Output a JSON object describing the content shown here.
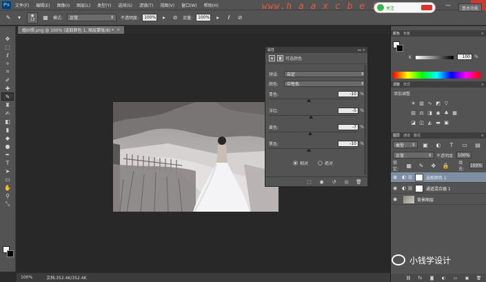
{
  "app": {
    "logo": "Ps",
    "menus": [
      "文件(F)",
      "编辑(E)",
      "图像(I)",
      "图层(L)",
      "类型(Y)",
      "选择(S)",
      "滤镜(T)",
      "视图(V)",
      "窗口(W)",
      "帮助(H)"
    ],
    "window_controls": [
      "—",
      "□",
      "✕"
    ]
  },
  "options_bar": {
    "brush_size": "13",
    "mode_label": "模式:",
    "mode_value": "正常",
    "opacity_label": "不透明度:",
    "opacity_value": "100%",
    "flow_label": "流量:",
    "flow_value": "100%",
    "workspace": "基本功能",
    "watermark": "www.h a a x c b e i . c o m",
    "badge_text": "关注"
  },
  "document": {
    "tab_title": "婚纱照.png @ 100% (选取颜色 1, 图层蒙版/8) *",
    "close": "×"
  },
  "status": {
    "zoom": "100%",
    "doc_info": "文档:352.4K/352.4K"
  },
  "properties": {
    "header": "属性",
    "title": "可选颜色",
    "preset_label": "预设:",
    "preset_value": "自定",
    "colors_label": "颜色:",
    "colors_value": "中性色",
    "sliders": [
      {
        "label": "青色:",
        "value": "-10",
        "unit": "%",
        "pct": -10
      },
      {
        "label": "洋红:",
        "value": "-5",
        "unit": "%",
        "pct": -5
      },
      {
        "label": "黄色:",
        "value": "-7",
        "unit": "%",
        "pct": -7
      },
      {
        "label": "黑色:",
        "value": "-10",
        "unit": "%",
        "pct": -10
      }
    ],
    "radio_relative": "相对",
    "radio_absolute": "绝对"
  },
  "color_panel": {
    "tabs": [
      "颜色",
      "色板"
    ],
    "k_label": "K",
    "k_value": "100",
    "k_unit": "%"
  },
  "adjust_panel": {
    "tabs": [
      "调整",
      "样式"
    ],
    "title": "添加调整"
  },
  "layers_panel": {
    "tabs": [
      "图层",
      "通道",
      "路径"
    ],
    "kind_value": "类型",
    "blend_value": "正常",
    "opacity_label": "不透明度:",
    "opacity_value": "100%",
    "lock_label": "锁定:",
    "fill_label": "填充:",
    "fill_value": "100%",
    "layers": [
      {
        "name": "选取颜色 1",
        "selected": true
      },
      {
        "name": "通道混合器 1",
        "selected": false
      },
      {
        "name": "背景图层",
        "selected": false
      }
    ]
  },
  "brand": {
    "text": "小钱学设计"
  }
}
